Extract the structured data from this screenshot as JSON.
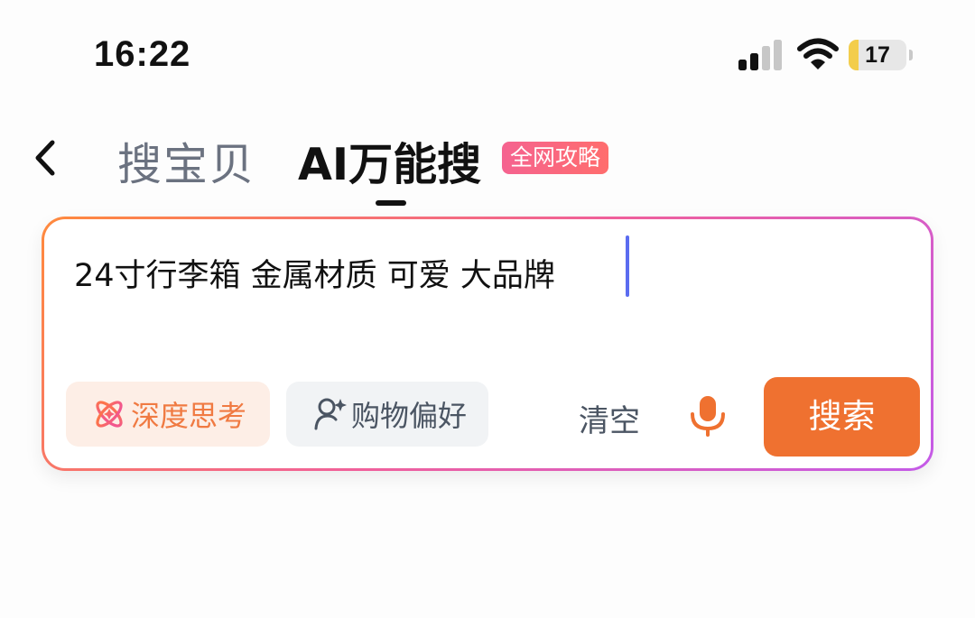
{
  "status_bar": {
    "time": "16:22",
    "battery_level": "17",
    "battery_fill_fraction": 0.17,
    "icons": [
      "cellular-signal-icon",
      "wifi-icon",
      "battery-icon"
    ]
  },
  "header": {
    "back_icon": "chevron-left-icon",
    "tabs": [
      {
        "label": "搜宝贝",
        "active": false
      },
      {
        "label": "AI万能搜",
        "active": true
      }
    ],
    "badge": "全网攻略"
  },
  "search": {
    "query": "24寸行李箱 金属材质 可爱 大品牌",
    "chips": [
      {
        "label": "深度思考",
        "icon": "atom-icon"
      },
      {
        "label": "购物偏好",
        "icon": "user-sparkle-icon"
      }
    ],
    "clear_label": "清空",
    "mic_icon": "microphone-icon",
    "submit_label": "搜索"
  },
  "colors": {
    "accent": "#ef7130",
    "badge_gradient": [
      "#f56390",
      "#ff6d6d"
    ],
    "panel_border_gradient": [
      "#ff8a3d",
      "#f0609b",
      "#c45be8"
    ],
    "caret": "#5b6cf0",
    "battery": "#f3cd4c"
  }
}
